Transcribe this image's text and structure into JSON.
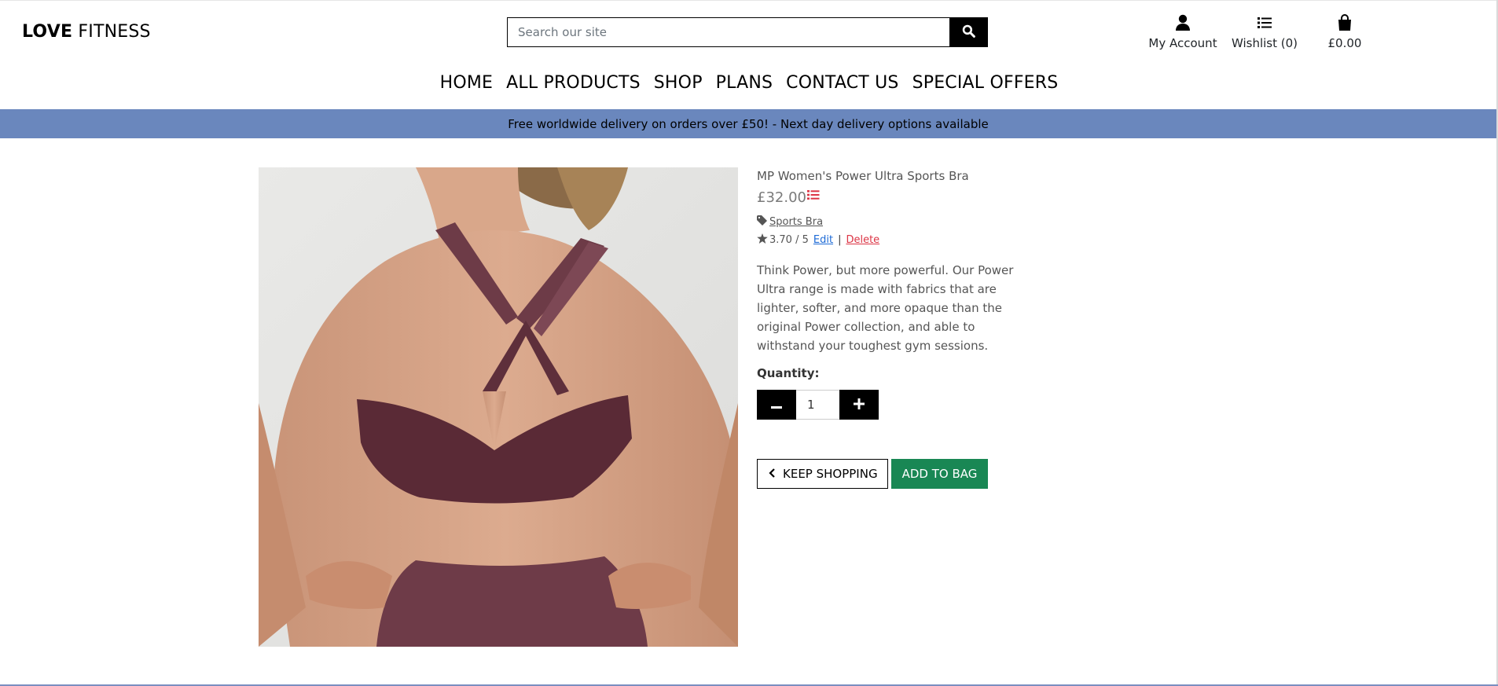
{
  "header": {
    "logo_bold": "LOVE",
    "logo_light": "FITNESS",
    "search_placeholder": "Search our site",
    "account_label": "My Account",
    "wishlist_label": "Wishlist (0)",
    "bag_total": "£0.00"
  },
  "nav": {
    "items": [
      "HOME",
      "ALL PRODUCTS",
      "SHOP",
      "PLANS",
      "CONTACT US",
      "SPECIAL OFFERS"
    ]
  },
  "banner": {
    "text": "Free worldwide delivery on orders over £50! - Next day delivery options available"
  },
  "product": {
    "name": "MP Women's Power Ultra Sports Bra",
    "price": "£32.00",
    "category": "Sports Bra",
    "rating": "3.70 / 5",
    "edit_label": "Edit",
    "separator": "|",
    "delete_label": "Delete",
    "description": "Think Power, but more powerful. Our Power Ultra range is made with fabrics that are lighter, softer, and more opaque than the original Power collection, and able to withstand your toughest gym sessions.",
    "quantity_label": "Quantity:",
    "quantity_value": "1",
    "keep_shopping_label": "KEEP SHOPPING",
    "add_to_bag_label": "ADD TO BAG"
  },
  "icons": {
    "search": "search-icon",
    "account": "user-icon",
    "wishlist": "list-icon",
    "bag": "shopping-bag-icon",
    "wishlist_add": "list-red-icon",
    "tag": "tag-icon",
    "star": "star-icon",
    "minus": "minus-icon",
    "plus": "plus-icon",
    "chevron": "chevron-left-icon"
  },
  "colors": {
    "banner": "#6a87bd",
    "add_to_bag": "#198754",
    "delete_link": "#dc3545",
    "edit_link": "#1d6ad6",
    "wishlist_icon": "#dc3545"
  }
}
